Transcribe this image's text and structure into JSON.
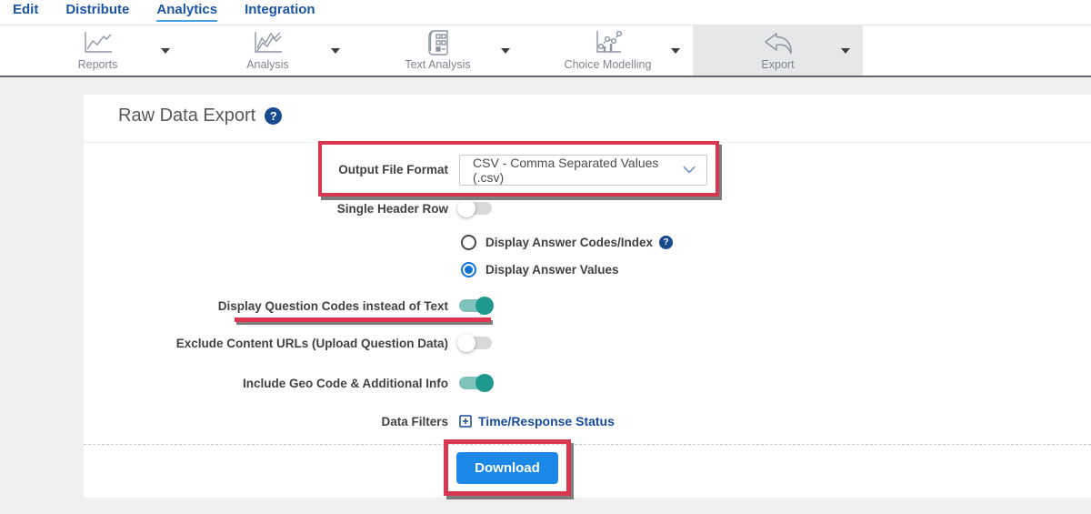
{
  "nav": {
    "items": [
      {
        "label": "Edit",
        "active": false
      },
      {
        "label": "Distribute",
        "active": false
      },
      {
        "label": "Analytics",
        "active": true
      },
      {
        "label": "Integration",
        "active": false
      }
    ]
  },
  "toolbar": {
    "items": [
      {
        "label": "Reports",
        "icon": "line-chart",
        "active": false
      },
      {
        "label": "Analysis",
        "icon": "multi-line-chart",
        "active": false
      },
      {
        "label": "Text Analysis",
        "icon": "document",
        "active": false
      },
      {
        "label": "Choice Modelling",
        "icon": "dot-chart",
        "active": false
      },
      {
        "label": "Export",
        "icon": "export-arrow",
        "active": true
      }
    ]
  },
  "page": {
    "title": "Raw Data Export"
  },
  "form": {
    "output_format": {
      "label": "Output File Format",
      "value": "CSV - Comma Separated Values (.csv)"
    },
    "single_header": {
      "label": "Single Header Row",
      "on": false
    },
    "answer_display": {
      "options": [
        {
          "label": "Display Answer Codes/Index",
          "selected": false,
          "has_help": true
        },
        {
          "label": "Display Answer Values",
          "selected": true,
          "has_help": false
        }
      ]
    },
    "question_codes": {
      "label": "Display Question Codes instead of Text",
      "on": true
    },
    "exclude_urls": {
      "label": "Exclude Content URLs (Upload Question Data)",
      "on": false
    },
    "geo_code": {
      "label": "Include Geo Code & Additional Info",
      "on": true
    },
    "data_filters": {
      "label": "Data Filters",
      "link": "Time/Response Status"
    },
    "download_label": "Download"
  },
  "colors": {
    "nav_blue": "#1a55a5",
    "nav_underline": "#45a3e2",
    "accent_blue": "#1b87e6",
    "link_blue": "#174b9f",
    "toggle_teal_on": "#1f998b",
    "toggle_track_on": "#7fc3bb",
    "radio_blue": "#1073d6",
    "annotation_red": "#d8374f",
    "toolbar_active_bg": "#e6e7e8",
    "help_icon_bg": "#174a8f"
  }
}
